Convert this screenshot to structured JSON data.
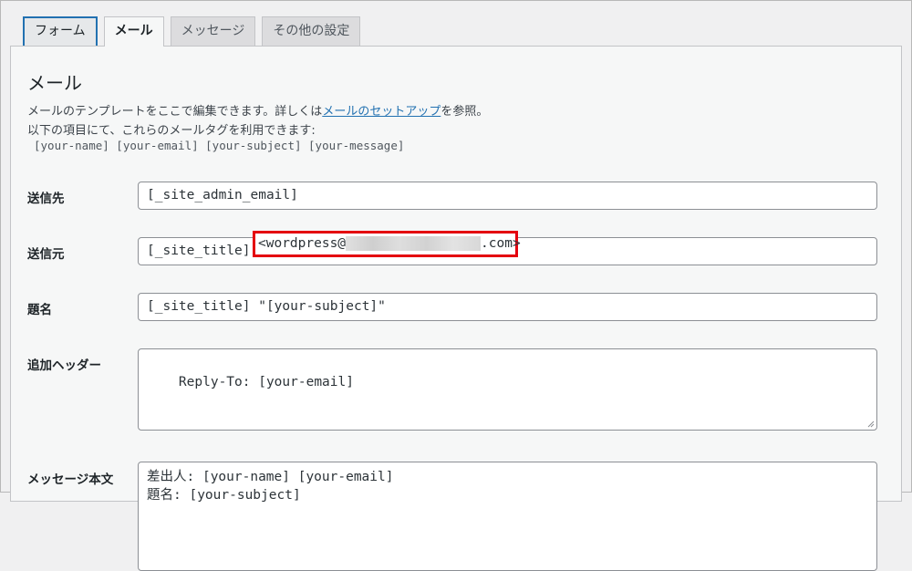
{
  "tabs": [
    {
      "label": "フォーム"
    },
    {
      "label": "メール"
    },
    {
      "label": "メッセージ"
    },
    {
      "label": "その他の設定"
    }
  ],
  "section": {
    "title": "メール",
    "description_prefix": "メールのテンプレートをここで編集できます。詳しくは",
    "description_link": "メールのセットアップ",
    "description_suffix": "を参照。",
    "tags_intro": "以下の項目にて、これらのメールタグを利用できます:",
    "tags": "[your-name] [your-email] [your-subject] [your-message]"
  },
  "fields": {
    "to": {
      "label": "送信先",
      "value": "[_site_admin_email]"
    },
    "from": {
      "label": "送信元",
      "value_prefix": "[_site_title]",
      "value_start": "<wordpress@",
      "value_end": ".com>"
    },
    "subject": {
      "label": "題名",
      "value": "[_site_title] \"[your-subject]\""
    },
    "headers": {
      "label": "追加ヘッダー",
      "value": "Reply-To: [your-email]"
    },
    "body": {
      "label": "メッセージ本文",
      "value": "差出人: [your-name] [your-email]\n題名: [your-subject]"
    }
  },
  "colors": {
    "highlight": "#e4000f",
    "link": "#2271b1",
    "focus": "#2271b1"
  }
}
